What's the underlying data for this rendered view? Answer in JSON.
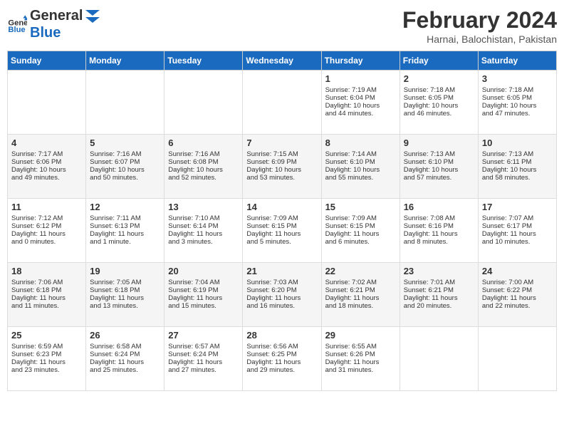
{
  "logo": {
    "line1": "General",
    "line2": "Blue"
  },
  "title": "February 2024",
  "location": "Harnai, Balochistan, Pakistan",
  "weekdays": [
    "Sunday",
    "Monday",
    "Tuesday",
    "Wednesday",
    "Thursday",
    "Friday",
    "Saturday"
  ],
  "weeks": [
    [
      {
        "day": "",
        "info": ""
      },
      {
        "day": "",
        "info": ""
      },
      {
        "day": "",
        "info": ""
      },
      {
        "day": "",
        "info": ""
      },
      {
        "day": "1",
        "info": "Sunrise: 7:19 AM\nSunset: 6:04 PM\nDaylight: 10 hours\nand 44 minutes."
      },
      {
        "day": "2",
        "info": "Sunrise: 7:18 AM\nSunset: 6:05 PM\nDaylight: 10 hours\nand 46 minutes."
      },
      {
        "day": "3",
        "info": "Sunrise: 7:18 AM\nSunset: 6:05 PM\nDaylight: 10 hours\nand 47 minutes."
      }
    ],
    [
      {
        "day": "4",
        "info": "Sunrise: 7:17 AM\nSunset: 6:06 PM\nDaylight: 10 hours\nand 49 minutes."
      },
      {
        "day": "5",
        "info": "Sunrise: 7:16 AM\nSunset: 6:07 PM\nDaylight: 10 hours\nand 50 minutes."
      },
      {
        "day": "6",
        "info": "Sunrise: 7:16 AM\nSunset: 6:08 PM\nDaylight: 10 hours\nand 52 minutes."
      },
      {
        "day": "7",
        "info": "Sunrise: 7:15 AM\nSunset: 6:09 PM\nDaylight: 10 hours\nand 53 minutes."
      },
      {
        "day": "8",
        "info": "Sunrise: 7:14 AM\nSunset: 6:10 PM\nDaylight: 10 hours\nand 55 minutes."
      },
      {
        "day": "9",
        "info": "Sunrise: 7:13 AM\nSunset: 6:10 PM\nDaylight: 10 hours\nand 57 minutes."
      },
      {
        "day": "10",
        "info": "Sunrise: 7:13 AM\nSunset: 6:11 PM\nDaylight: 10 hours\nand 58 minutes."
      }
    ],
    [
      {
        "day": "11",
        "info": "Sunrise: 7:12 AM\nSunset: 6:12 PM\nDaylight: 11 hours\nand 0 minutes."
      },
      {
        "day": "12",
        "info": "Sunrise: 7:11 AM\nSunset: 6:13 PM\nDaylight: 11 hours\nand 1 minute."
      },
      {
        "day": "13",
        "info": "Sunrise: 7:10 AM\nSunset: 6:14 PM\nDaylight: 11 hours\nand 3 minutes."
      },
      {
        "day": "14",
        "info": "Sunrise: 7:09 AM\nSunset: 6:15 PM\nDaylight: 11 hours\nand 5 minutes."
      },
      {
        "day": "15",
        "info": "Sunrise: 7:09 AM\nSunset: 6:15 PM\nDaylight: 11 hours\nand 6 minutes."
      },
      {
        "day": "16",
        "info": "Sunrise: 7:08 AM\nSunset: 6:16 PM\nDaylight: 11 hours\nand 8 minutes."
      },
      {
        "day": "17",
        "info": "Sunrise: 7:07 AM\nSunset: 6:17 PM\nDaylight: 11 hours\nand 10 minutes."
      }
    ],
    [
      {
        "day": "18",
        "info": "Sunrise: 7:06 AM\nSunset: 6:18 PM\nDaylight: 11 hours\nand 11 minutes."
      },
      {
        "day": "19",
        "info": "Sunrise: 7:05 AM\nSunset: 6:18 PM\nDaylight: 11 hours\nand 13 minutes."
      },
      {
        "day": "20",
        "info": "Sunrise: 7:04 AM\nSunset: 6:19 PM\nDaylight: 11 hours\nand 15 minutes."
      },
      {
        "day": "21",
        "info": "Sunrise: 7:03 AM\nSunset: 6:20 PM\nDaylight: 11 hours\nand 16 minutes."
      },
      {
        "day": "22",
        "info": "Sunrise: 7:02 AM\nSunset: 6:21 PM\nDaylight: 11 hours\nand 18 minutes."
      },
      {
        "day": "23",
        "info": "Sunrise: 7:01 AM\nSunset: 6:21 PM\nDaylight: 11 hours\nand 20 minutes."
      },
      {
        "day": "24",
        "info": "Sunrise: 7:00 AM\nSunset: 6:22 PM\nDaylight: 11 hours\nand 22 minutes."
      }
    ],
    [
      {
        "day": "25",
        "info": "Sunrise: 6:59 AM\nSunset: 6:23 PM\nDaylight: 11 hours\nand 23 minutes."
      },
      {
        "day": "26",
        "info": "Sunrise: 6:58 AM\nSunset: 6:24 PM\nDaylight: 11 hours\nand 25 minutes."
      },
      {
        "day": "27",
        "info": "Sunrise: 6:57 AM\nSunset: 6:24 PM\nDaylight: 11 hours\nand 27 minutes."
      },
      {
        "day": "28",
        "info": "Sunrise: 6:56 AM\nSunset: 6:25 PM\nDaylight: 11 hours\nand 29 minutes."
      },
      {
        "day": "29",
        "info": "Sunrise: 6:55 AM\nSunset: 6:26 PM\nDaylight: 11 hours\nand 31 minutes."
      },
      {
        "day": "",
        "info": ""
      },
      {
        "day": "",
        "info": ""
      }
    ]
  ]
}
